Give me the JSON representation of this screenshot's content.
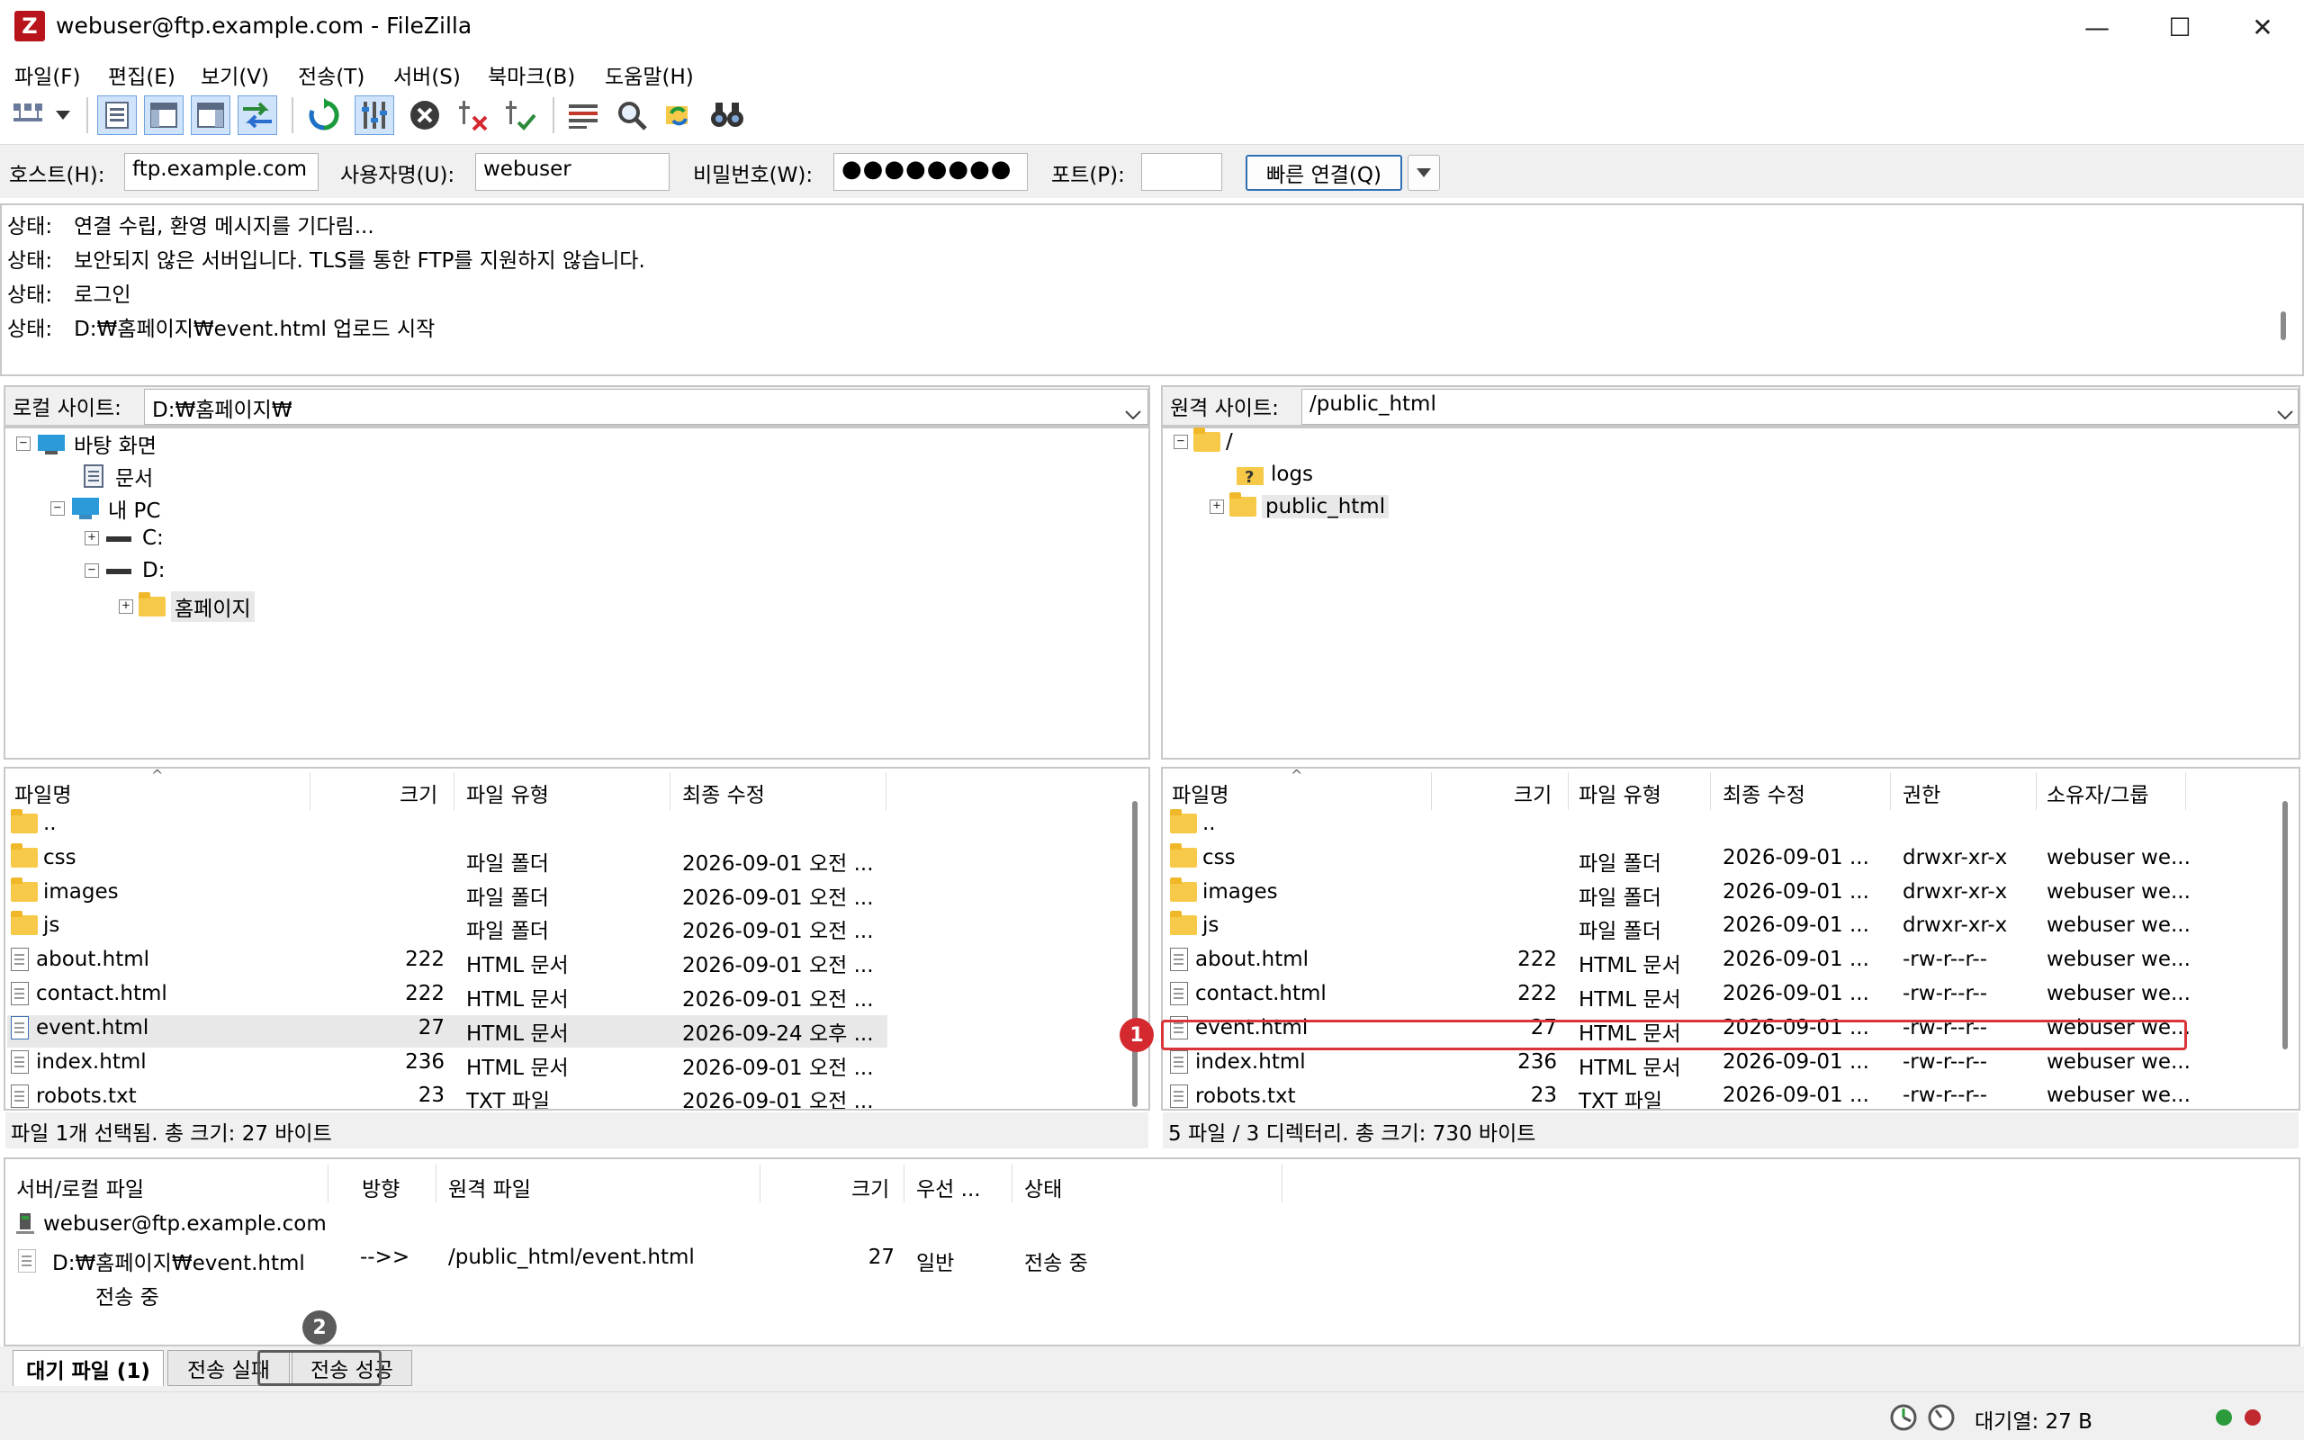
{
  "window": {
    "title": "webuser@ftp.example.com - FileZilla",
    "minimize": "—",
    "maximize": "☐",
    "close": "✕"
  },
  "menu": [
    "파일(F)",
    "편집(E)",
    "보기(V)",
    "전송(T)",
    "서버(S)",
    "북마크(B)",
    "도움말(H)"
  ],
  "quickconnect": {
    "host_label": "호스트(H):",
    "host": "ftp.example.com",
    "user_label": "사용자명(U):",
    "user": "webuser",
    "pass_label": "비밀번호(W):",
    "pass": "●●●●●●●●",
    "port_label": "포트(P):",
    "port": "",
    "connect_label": "빠른 연결(Q)"
  },
  "log": [
    {
      "label": "상태:",
      "text": "연결 수립, 환영 메시지를 기다림..."
    },
    {
      "label": "상태:",
      "text": "보안되지 않은 서버입니다. TLS를 통한 FTP를 지원하지 않습니다."
    },
    {
      "label": "상태:",
      "text": "로그인"
    },
    {
      "label": "상태:",
      "text": "D:₩홈페이지₩event.html 업로드 시작"
    }
  ],
  "local": {
    "site_label": "로컬 사이트:",
    "path": "D:₩홈페이지₩",
    "tree": [
      "바탕 화면",
      "문서",
      "내 PC",
      "C:",
      "D:",
      "홈페이지"
    ],
    "columns": [
      "파일명",
      "크기",
      "파일 유형",
      "최종 수정"
    ],
    "files": [
      {
        "name": "..",
        "size": "",
        "type": "",
        "modified": ""
      },
      {
        "name": "css",
        "size": "",
        "type": "파일 폴더",
        "modified": "2026-09-01 오전 ..."
      },
      {
        "name": "images",
        "size": "",
        "type": "파일 폴더",
        "modified": "2026-09-01 오전 ..."
      },
      {
        "name": "js",
        "size": "",
        "type": "파일 폴더",
        "modified": "2026-09-01 오전 ..."
      },
      {
        "name": "about.html",
        "size": "222",
        "type": "HTML 문서",
        "modified": "2026-09-01 오전 ..."
      },
      {
        "name": "contact.html",
        "size": "222",
        "type": "HTML 문서",
        "modified": "2026-09-01 오전 ..."
      },
      {
        "name": "event.html",
        "size": "27",
        "type": "HTML 문서",
        "modified": "2026-09-24 오후 ..."
      },
      {
        "name": "index.html",
        "size": "236",
        "type": "HTML 문서",
        "modified": "2026-09-01 오전 ..."
      },
      {
        "name": "robots.txt",
        "size": "23",
        "type": "TXT 파일",
        "modified": "2026-09-01 오전 ..."
      }
    ],
    "status": "파일 1개 선택됨. 총 크기: 27 바이트"
  },
  "remote": {
    "site_label": "원격 사이트:",
    "path": "/public_html",
    "tree": [
      "/",
      "logs",
      "public_html"
    ],
    "columns": [
      "파일명",
      "크기",
      "파일 유형",
      "최종 수정",
      "권한",
      "소유자/그룹"
    ],
    "files": [
      {
        "name": "..",
        "size": "",
        "type": "",
        "modified": "",
        "perm": "",
        "owner": ""
      },
      {
        "name": "css",
        "size": "",
        "type": "파일 폴더",
        "modified": "2026-09-01 ...",
        "perm": "drwxr-xr-x",
        "owner": "webuser we..."
      },
      {
        "name": "images",
        "size": "",
        "type": "파일 폴더",
        "modified": "2026-09-01 ...",
        "perm": "drwxr-xr-x",
        "owner": "webuser we..."
      },
      {
        "name": "js",
        "size": "",
        "type": "파일 폴더",
        "modified": "2026-09-01 ...",
        "perm": "drwxr-xr-x",
        "owner": "webuser we..."
      },
      {
        "name": "about.html",
        "size": "222",
        "type": "HTML 문서",
        "modified": "2026-09-01 ...",
        "perm": "-rw-r--r--",
        "owner": "webuser we..."
      },
      {
        "name": "contact.html",
        "size": "222",
        "type": "HTML 문서",
        "modified": "2026-09-01 ...",
        "perm": "-rw-r--r--",
        "owner": "webuser we..."
      },
      {
        "name": "event.html",
        "size": "27",
        "type": "HTML 문서",
        "modified": "2026-09-01 ...",
        "perm": "-rw-r--r--",
        "owner": "webuser we..."
      },
      {
        "name": "index.html",
        "size": "236",
        "type": "HTML 문서",
        "modified": "2026-09-01 ...",
        "perm": "-rw-r--r--",
        "owner": "webuser we..."
      },
      {
        "name": "robots.txt",
        "size": "23",
        "type": "TXT 파일",
        "modified": "2026-09-01 ...",
        "perm": "-rw-r--r--",
        "owner": "webuser we..."
      }
    ],
    "status": "5 파일 / 3 디렉터리. 총 크기: 730 바이트"
  },
  "queue": {
    "columns": [
      "서버/로컬 파일",
      "방향",
      "원격 파일",
      "크기",
      "우선 ...",
      "상태"
    ],
    "server": "webuser@ftp.example.com",
    "item": {
      "local": "D:₩홈페이지₩event.html",
      "dir": "-->>",
      "remote": "/public_html/event.html",
      "size": "27",
      "priority": "일반",
      "status": "전송 중"
    },
    "substatus": "전송 중",
    "tabs": [
      "대기 파일 (1)",
      "전송 실패",
      "전송 성공"
    ]
  },
  "markers": [
    "1",
    "2"
  ],
  "statusbar": {
    "queue": "대기열: 27 B"
  },
  "colors": {
    "highlight": "#d9343a",
    "marker_1": "#d42a2f",
    "marker_2": "#5b5b5b",
    "selected_row": "#e8e8e8"
  }
}
